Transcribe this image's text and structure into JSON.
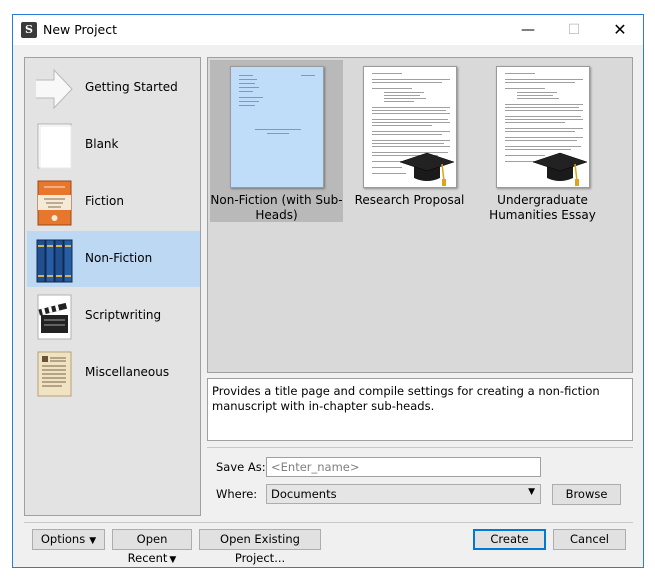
{
  "window": {
    "title": "New Project",
    "app_icon_letter": "S",
    "minimize_glyph": "—",
    "maximize_glyph": "☐",
    "close_glyph": "✕"
  },
  "categories": [
    {
      "label": "Getting Started",
      "icon": "arrow-icon"
    },
    {
      "label": "Blank",
      "icon": "blank-page-icon"
    },
    {
      "label": "Fiction",
      "icon": "book-cover-icon"
    },
    {
      "label": "Non-Fiction",
      "icon": "books-icon",
      "selected": true
    },
    {
      "label": "Scriptwriting",
      "icon": "clapperboard-icon"
    },
    {
      "label": "Miscellaneous",
      "icon": "parchment-icon"
    }
  ],
  "templates": [
    {
      "label": "Non-Fiction (with Sub-Heads)",
      "selected": true
    },
    {
      "label": "Research Proposal"
    },
    {
      "label": "Undergraduate Humanities Essay"
    }
  ],
  "description": "Provides a title page and compile settings for creating a non-fiction manuscript with in-chapter sub-heads.",
  "form": {
    "save_as_label": "Save As:",
    "save_as_placeholder": "<Enter_name>",
    "where_label": "Where:",
    "where_value": "Documents",
    "browse_label": "Browse"
  },
  "footer": {
    "options_label": "Options",
    "open_recent_label": "Open Recent",
    "open_existing_label": "Open Existing Project...",
    "create_label": "Create",
    "cancel_label": "Cancel"
  },
  "colors": {
    "selection": "#bcd8f3",
    "window_border": "#2b7ed7",
    "default_button": "#0078d7"
  }
}
